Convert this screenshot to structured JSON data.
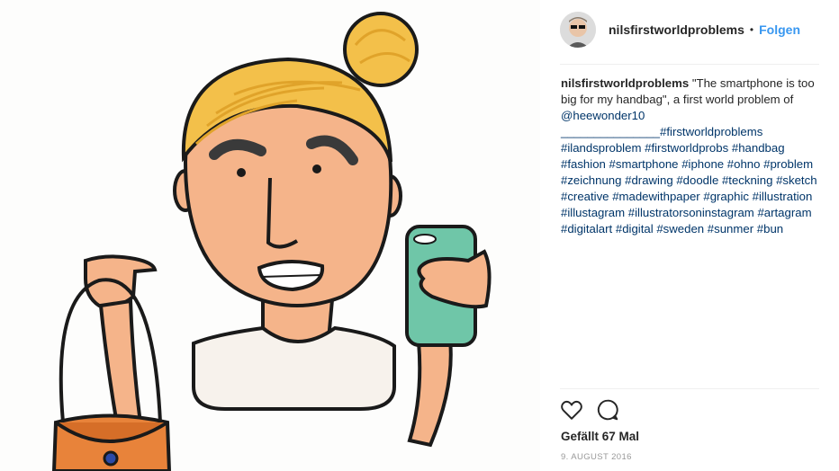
{
  "post": {
    "username": "nilsfirstworldproblems",
    "separator": "•",
    "follow_label": "Folgen",
    "caption_username": "nilsfirstworldproblems",
    "caption_text": "\"The smartphone is too big for my handbag\", a first world problem of ",
    "mention": "@heewonder10",
    "underline_line": "_______________",
    "hashtags": [
      "#firstworldproblems",
      "#ilandsproblem",
      "#firstworldprobs",
      "#handbag",
      "#fashion",
      "#smartphone",
      "#iphone",
      "#ohno",
      "#problem",
      "#zeichnung",
      "#drawing",
      "#doodle",
      "#teckning",
      "#sketch",
      "#creative",
      "#madewithpaper",
      "#graphic",
      "#illustration",
      "#illustagram",
      "#illustratorsoninstagram",
      "#artagram",
      "#digitalart",
      "#digital",
      "#sweden",
      "#sunmer",
      "#bun"
    ],
    "likes": "Gefällt 67 Mal",
    "date": "9. AUGUST 2016"
  },
  "icons": {
    "like": "heart-icon",
    "comment": "comment-icon"
  },
  "colors": {
    "link": "#003569",
    "follow": "#3897f0",
    "skin": "#f5b48a",
    "hair": "#f3c04a",
    "phone": "#6fc6a8",
    "bag": "#e8833a"
  }
}
